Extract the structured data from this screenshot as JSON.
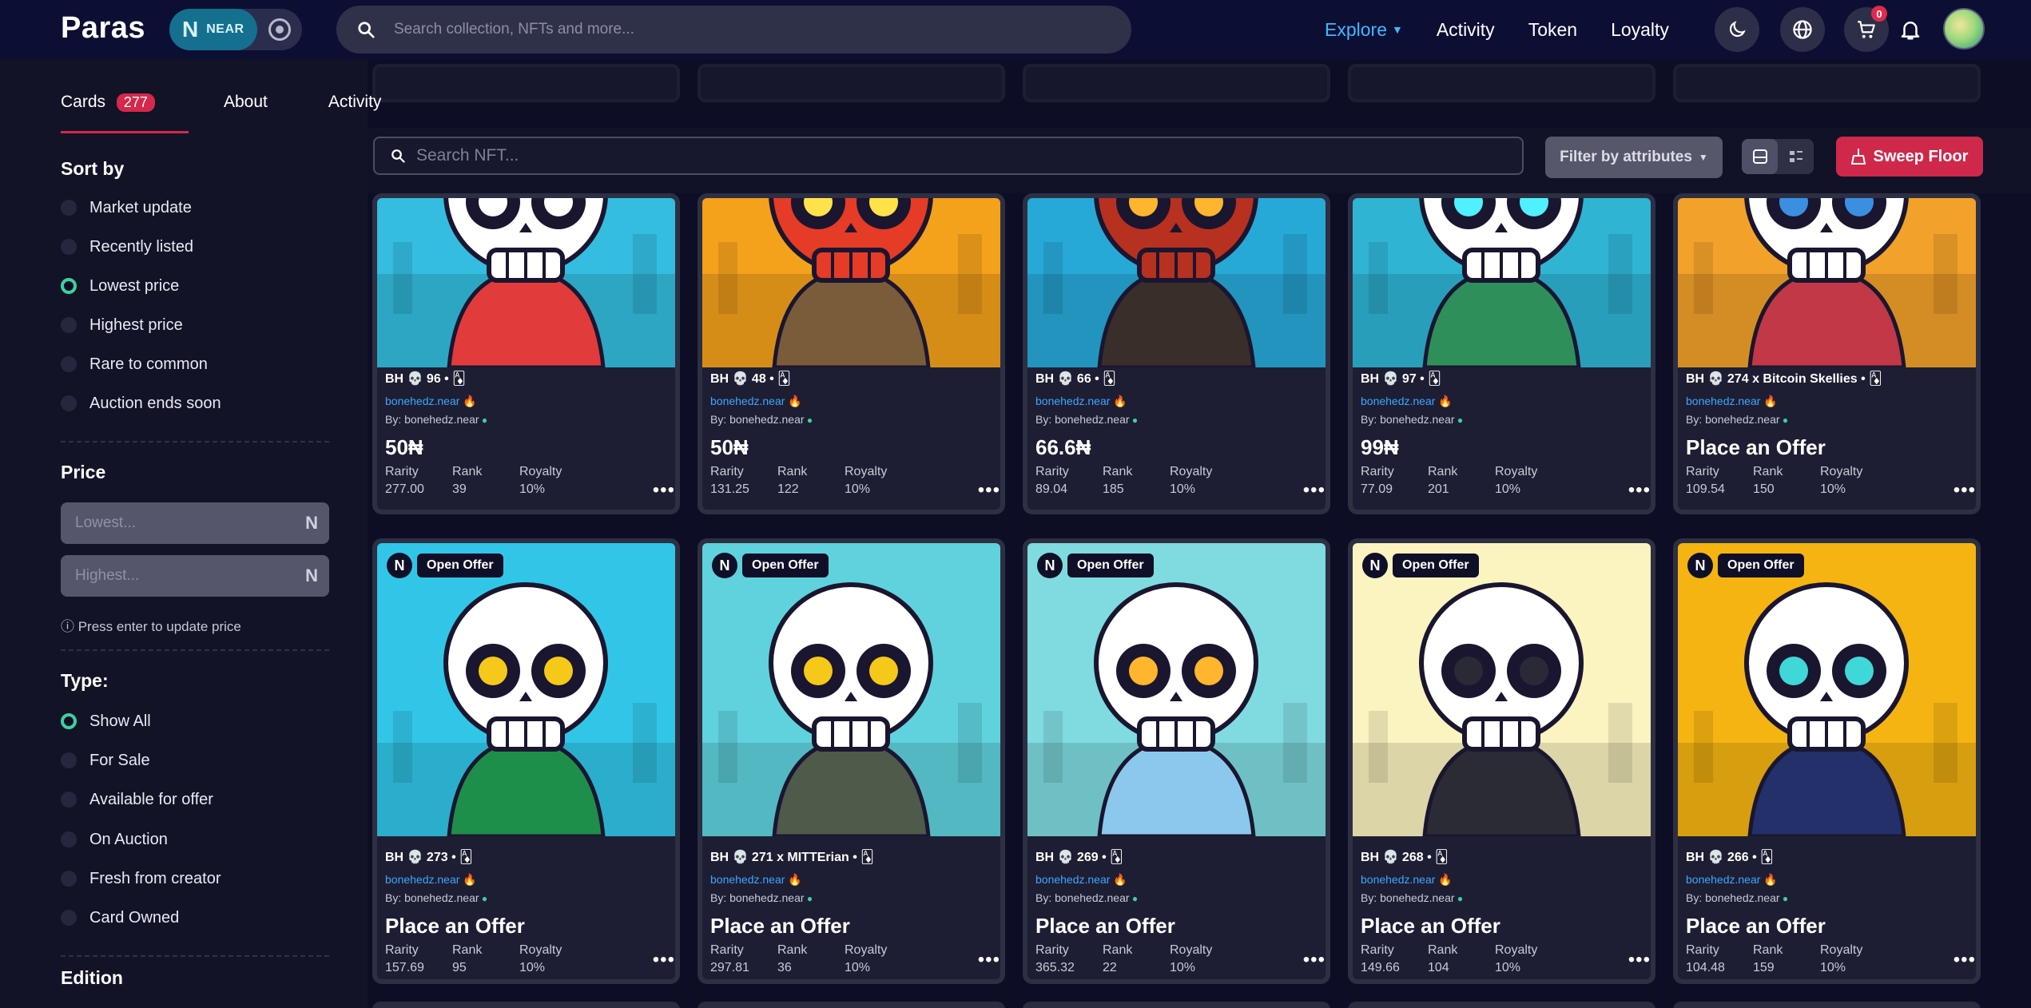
{
  "navbar": {
    "logo": "Paras",
    "chain": {
      "glyph": "N",
      "label": "NEAR"
    },
    "search_placeholder": "Search collection, NFTs and more...",
    "links": [
      {
        "label": "Explore",
        "active": true
      },
      {
        "label": "Activity",
        "active": false
      },
      {
        "label": "Token",
        "active": false
      },
      {
        "label": "Loyalty",
        "active": false
      }
    ],
    "cart_count": "0"
  },
  "sidebar": {
    "tabs": {
      "cards": "Cards",
      "cards_count": "277",
      "about": "About",
      "activity": "Activity"
    },
    "sort_title": "Sort by",
    "sort_options": [
      "Market update",
      "Recently listed",
      "Lowest price",
      "Highest price",
      "Rare to common",
      "Auction ends soon"
    ],
    "sort_selected": "Lowest price",
    "price_title": "Price",
    "price_low_placeholder": "Lowest...",
    "price_high_placeholder": "Highest...",
    "near_glyph": "N",
    "price_hint": "ⓘ Press enter to update price",
    "type_title": "Type:",
    "type_options": [
      "Show All",
      "For Sale",
      "Available for offer",
      "On Auction",
      "Fresh from creator",
      "Card Owned"
    ],
    "type_selected": "Show All",
    "edition_title": "Edition"
  },
  "toolbar": {
    "search_placeholder": "Search NFT...",
    "filter_label": "Filter by attributes",
    "sweep_label": "Sweep Floor"
  },
  "labels": {
    "rarity": "Rarity",
    "rank": "Rank",
    "royalty": "Royalty",
    "by_prefix": "By:",
    "open_offer": "Open Offer",
    "more": "•••"
  },
  "colors": {
    "accent_red": "#d6284b",
    "link_blue": "#3fa6ff",
    "radio_green": "#3fcf9f",
    "explore_blue": "#40b8ff"
  },
  "cards_row1": [
    {
      "name": "BH 💀 96 • 🃁",
      "owner": "bonehedz.near 🔥",
      "creator": "bonehedz.near",
      "price": "50₦",
      "rarity": "277.00",
      "rank": "39",
      "royalty": "10%",
      "bg": "#34bde0",
      "skull": "#ffffff",
      "eye": "#ffffff",
      "accent": "#e23b3b"
    },
    {
      "name": "BH 💀 48 • 🃁",
      "owner": "bonehedz.near 🔥",
      "creator": "bonehedz.near",
      "price": "50₦",
      "rarity": "131.25",
      "rank": "122",
      "royalty": "10%",
      "bg": "#f4a11c",
      "skull": "#e63b27",
      "eye": "#ffe24a",
      "accent": "#7a5c3a"
    },
    {
      "name": "BH 💀 66 • 🃁",
      "owner": "bonehedz.near 🔥",
      "creator": "bonehedz.near",
      "price": "66.6₦",
      "rarity": "89.04",
      "rank": "185",
      "royalty": "10%",
      "bg": "#27a9d8",
      "skull": "#b8301f",
      "eye": "#ffb52e",
      "accent": "#3a2e2a"
    },
    {
      "name": "BH 💀 97 • 🃁",
      "owner": "bonehedz.near 🔥",
      "creator": "bonehedz.near",
      "price": "99₦",
      "rarity": "77.09",
      "rank": "201",
      "royalty": "10%",
      "bg": "#2fb4d4",
      "skull": "#ffffff",
      "eye": "#4ff0ff",
      "accent": "#2f8f5a"
    },
    {
      "name": "BH 💀 274 x Bitcoin Skellies • 🃁",
      "owner": "bonehedz.near 🔥",
      "creator": "bonehedz.near",
      "price": "Place an Offer",
      "rarity": "109.54",
      "rank": "150",
      "royalty": "10%",
      "bg": "#f2a12a",
      "skull": "#ffffff",
      "eye": "#3a8fe0",
      "accent": "#c33846"
    }
  ],
  "cards_row2": [
    {
      "name": "BH 💀 273 • 🃁",
      "owner": "bonehedz.near 🔥",
      "creator": "bonehedz.near",
      "price": "Place an Offer",
      "rarity": "157.69",
      "rank": "95",
      "royalty": "10%",
      "bg": "#31c6e8",
      "skull": "#ffffff",
      "eye": "#f5c81a",
      "accent": "#1e8f4a"
    },
    {
      "name": "BH 💀 271 x MITTErian • 🃁",
      "owner": "bonehedz.near 🔥",
      "creator": "bonehedz.near",
      "price": "Place an Offer",
      "rarity": "297.81",
      "rank": "36",
      "royalty": "10%",
      "bg": "#5fd2dd",
      "skull": "#ffffff",
      "eye": "#f5c81a",
      "accent": "#4e5a4a"
    },
    {
      "name": "BH 💀 269 • 🃁",
      "owner": "bonehedz.near 🔥",
      "creator": "bonehedz.near",
      "price": "Place an Offer",
      "rarity": "365.32",
      "rank": "22",
      "royalty": "10%",
      "bg": "#7fdbe0",
      "skull": "#ffffff",
      "eye": "#ffb52e",
      "accent": "#8cc8ee"
    },
    {
      "name": "BH 💀 268 • 🃁",
      "owner": "bonehedz.near 🔥",
      "creator": "bonehedz.near",
      "price": "Place an Offer",
      "rarity": "149.66",
      "rank": "104",
      "royalty": "10%",
      "bg": "#fbf3c0",
      "skull": "#ffffff",
      "eye": "#2a2a36",
      "accent": "#2b2b35"
    },
    {
      "name": "BH 💀 266 • 🃁",
      "owner": "bonehedz.near 🔥",
      "creator": "bonehedz.near",
      "price": "Place an Offer",
      "rarity": "104.48",
      "rank": "159",
      "royalty": "10%",
      "bg": "#f5b412",
      "skull": "#ffffff",
      "eye": "#3fd7d7",
      "accent": "#23306a"
    }
  ]
}
